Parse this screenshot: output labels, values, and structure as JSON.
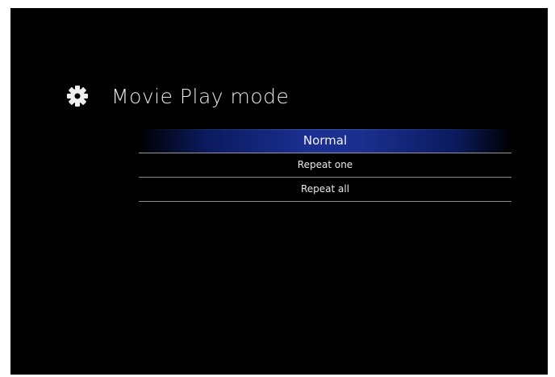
{
  "page": {
    "title": "Movie Play mode",
    "icon": "gear-icon"
  },
  "menu": {
    "items": [
      {
        "label": "Normal",
        "selected": true
      },
      {
        "label": "Repeat one",
        "selected": false
      },
      {
        "label": "Repeat all",
        "selected": false
      }
    ]
  },
  "colors": {
    "background": "#000000",
    "highlight": "#1a2f8f",
    "text": "#e8e8e8",
    "divider": "#8a8a8a"
  }
}
